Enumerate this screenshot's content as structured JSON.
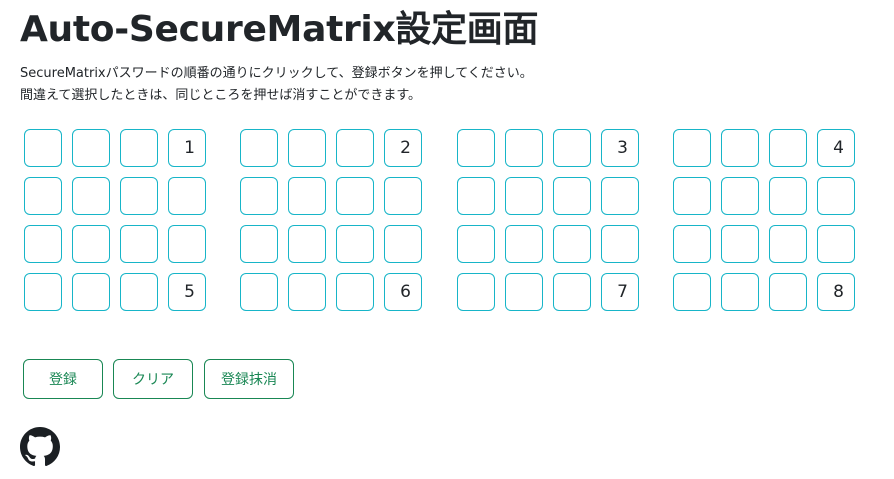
{
  "page": {
    "title": "Auto-SecureMatrix設定画面",
    "instructions": [
      "SecureMatrixパスワードの順番の通りにクリックして、登録ボタンを押してください。",
      "間違えて選択したときは、同じところを押せば消すことができます。"
    ]
  },
  "matrix": {
    "blocks": 8,
    "rows_per_block": 4,
    "cols_per_block": 4,
    "selected": [
      {
        "block": 1,
        "row": 1,
        "col": 4,
        "label": "1"
      },
      {
        "block": 2,
        "row": 1,
        "col": 4,
        "label": "2"
      },
      {
        "block": 3,
        "row": 1,
        "col": 4,
        "label": "3"
      },
      {
        "block": 4,
        "row": 1,
        "col": 4,
        "label": "4"
      },
      {
        "block": 1,
        "row": 4,
        "col": 4,
        "label": "5"
      },
      {
        "block": 2,
        "row": 4,
        "col": 4,
        "label": "6"
      },
      {
        "block": 3,
        "row": 4,
        "col": 4,
        "label": "7"
      },
      {
        "block": 4,
        "row": 4,
        "col": 4,
        "label": "8"
      }
    ]
  },
  "buttons": {
    "register": "登録",
    "clear": "クリア",
    "delete": "登録抹消"
  },
  "footer": {
    "link_icon": "github-icon"
  },
  "colors": {
    "cell_border": "#17b5c8",
    "button": "#198754",
    "text": "#212529"
  }
}
